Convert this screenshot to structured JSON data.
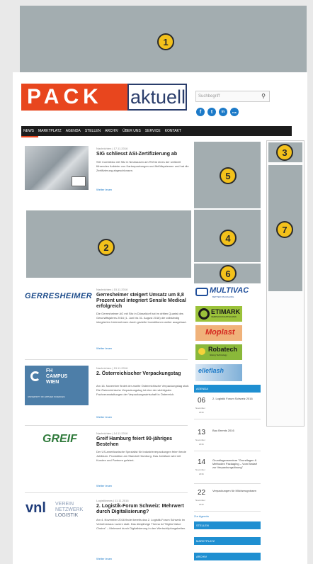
{
  "slots": [
    {
      "id": "1",
      "desc": "top leaderboard"
    },
    {
      "id": "2",
      "desc": "content banner"
    },
    {
      "id": "3",
      "desc": "small tile"
    },
    {
      "id": "4",
      "desc": "sidebar middle"
    },
    {
      "id": "5",
      "desc": "sidebar top"
    },
    {
      "id": "6",
      "desc": "sidebar strip"
    },
    {
      "id": "7",
      "desc": "skyscraper"
    }
  ],
  "header": {
    "logo_pack": "PACK",
    "logo_aktuell": "aktuell",
    "search_placeholder": "Suchbegriff",
    "search_icon": "magnifier-icon",
    "social": [
      "f",
      "t",
      "in",
      "rss"
    ]
  },
  "nav": [
    "NEWS",
    "MARKTPLATZ",
    "AGENDA",
    "STELLEN",
    "ARCHIV",
    "ÜBER UNS",
    "SERVICE",
    "KONTAKT"
  ],
  "articles": [
    {
      "meta": "Nachrichten | 17.11.2016",
      "title": "SIG schliesst ASI-Zertifizierung ab",
      "excerpt": "SIG Combibloc mit Sitz in Neuhausen am Rhf ist eines der weltweit führenden Anbieter von Kartonpackungen und Abfüllsystemen und hat die Zertifizierung abgeschlossen.",
      "more": "Weiter lesen"
    },
    {
      "meta": "Nachrichten | 15.11.2016",
      "logo": "GERRESHEIMER",
      "title": "Gerresheimer steigert Umsatz um 8,8 Prozent und integriert Sensile Medical erfolgreich",
      "excerpt": "Die Gerresheimer AG mit Sitz in Düsseldorf hat im dritten Quartal des Geschäftsjahres 2016 (1. Juni bis 31. August 2016) die vollständig integrierten Unternehmen durch gezielte Investitionen weiter ausgebaut.",
      "more": "Weiter lesen"
    },
    {
      "meta": "Nachrichten | 15.11.2016",
      "logo_line1": "FH",
      "logo_line2": "CAMPUS",
      "logo_line3": "WIEN",
      "logo_sub": "UNIVERSITY OF APPLIED SCIENCES",
      "title": "2. Österreichischer Verpackungstag",
      "excerpt": "Am 16. November findet der zweite Österreichische Verpackungstag statt. Die Österreichische Verpackungstag ist eine der wichtigsten Fachveranstaltungen der Verpackungswirtschaft in Österreich.",
      "more": "Weiter lesen"
    },
    {
      "meta": "Nachrichten | 14.11.2016",
      "logo": "GREIF",
      "title": "Greif Hamburg feiert 90-jähriges Bestehen",
      "excerpt": "Der US-amerikanische Spezialist für Industrieverpackungen feiert heute Jubiläum. Produktion am Standort Hamburg. Das Jubiläum wird mit Kunden und Partnern gefeiert.",
      "more": "Weiter lesen"
    },
    {
      "meta": "Logistiknews | 11.11.2016",
      "logo": "vnl",
      "logo_sub1": "VEREIN",
      "logo_sub2": "NETZWERK",
      "logo_sub3": "LOGISTIK",
      "title": "2. Logistik-Forum Schweiz: Mehrwert durch Digitalisierung?",
      "excerpt": "Am 4. November 2016 findet bereits das 2. Logistik-Forum Schweiz im Verkehrshaus Luzern statt. Das diesjährige Thema ist \"Digital Value Chains\" – Mehrwert durch Digitalisierung in den Wertschöpfungsketten.",
      "more": "Weiter lesen"
    }
  ],
  "sponsors": [
    {
      "name": "MULTIVAC",
      "sub": "BETTER PACKAGING",
      "color": "#1f4e9a"
    },
    {
      "name": "ETIMARK",
      "sub": "VERPACKUNGSTECHNIK",
      "color": "#1a1a1a"
    },
    {
      "name": "Moplast",
      "sub": "",
      "color": "#d4281f"
    },
    {
      "name": "Robatech",
      "sub": "Gluing Technology",
      "color": "#1a1a1a"
    },
    {
      "name": "elleflash",
      "sub": "",
      "color": "#1c7ac8"
    }
  ],
  "agenda": {
    "header": "AGENDA",
    "items": [
      {
        "day": "06",
        "month": "November",
        "year": "2016",
        "title": "2. Logistik Forum Schweiz 2016"
      },
      {
        "day": "13",
        "month": "November",
        "year": "2016",
        "title": "Bau Bremis 2016"
      },
      {
        "day": "14",
        "month": "November",
        "year": "2016",
        "title": "Grundlagenseminar \"Grundlagen & Methoden Packaging – Vom Bedarf zur Verpackungslösung\""
      },
      {
        "day": "22",
        "month": "November",
        "year": "2016",
        "title": "Verpackungen für Milchzeugnissen"
      }
    ],
    "link": "Zur Agenda"
  },
  "bluebars": [
    "STELLEN",
    "MARKTPLATZ",
    "ARCHIV"
  ]
}
